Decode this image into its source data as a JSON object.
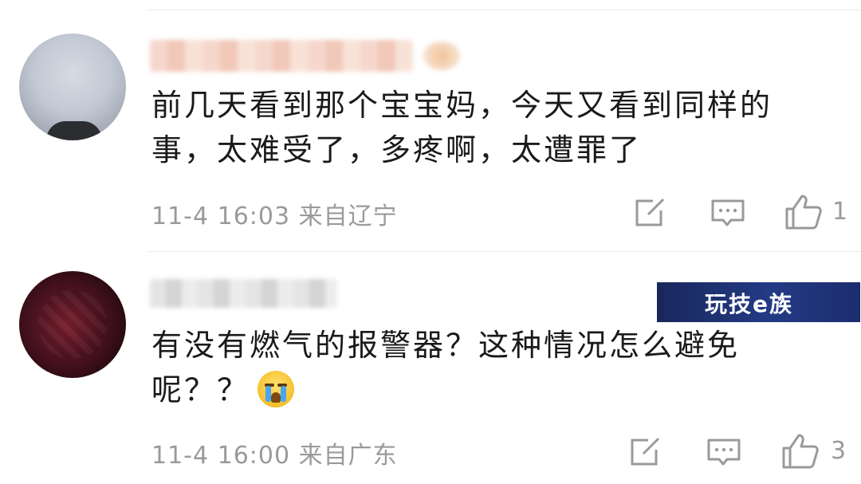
{
  "comments": [
    {
      "content_line1": "前几天看到那个宝宝妈，今天又看到同样的",
      "content_line2": "事，太难受了，多疼啊，太遭罪了",
      "meta": "11-4 16:03 来自辽宁",
      "like_count": "1"
    },
    {
      "content_line1": "有没有燃气的报警器？这种情况怎么避免",
      "content_line2": "呢？？",
      "meta": "11-4 16:00 来自广东",
      "like_count": "3"
    }
  ],
  "icons": {
    "share": "share-edit-icon",
    "reply": "comment-bubble-icon",
    "like": "thumbs-up-icon",
    "emoji": "crying-face-emoji"
  },
  "watermark": {
    "text": "玩技e族"
  },
  "colors": {
    "meta_text": "#9a9a9a",
    "content_text": "#1a1a1a",
    "watermark_bg": "#1f3377"
  }
}
